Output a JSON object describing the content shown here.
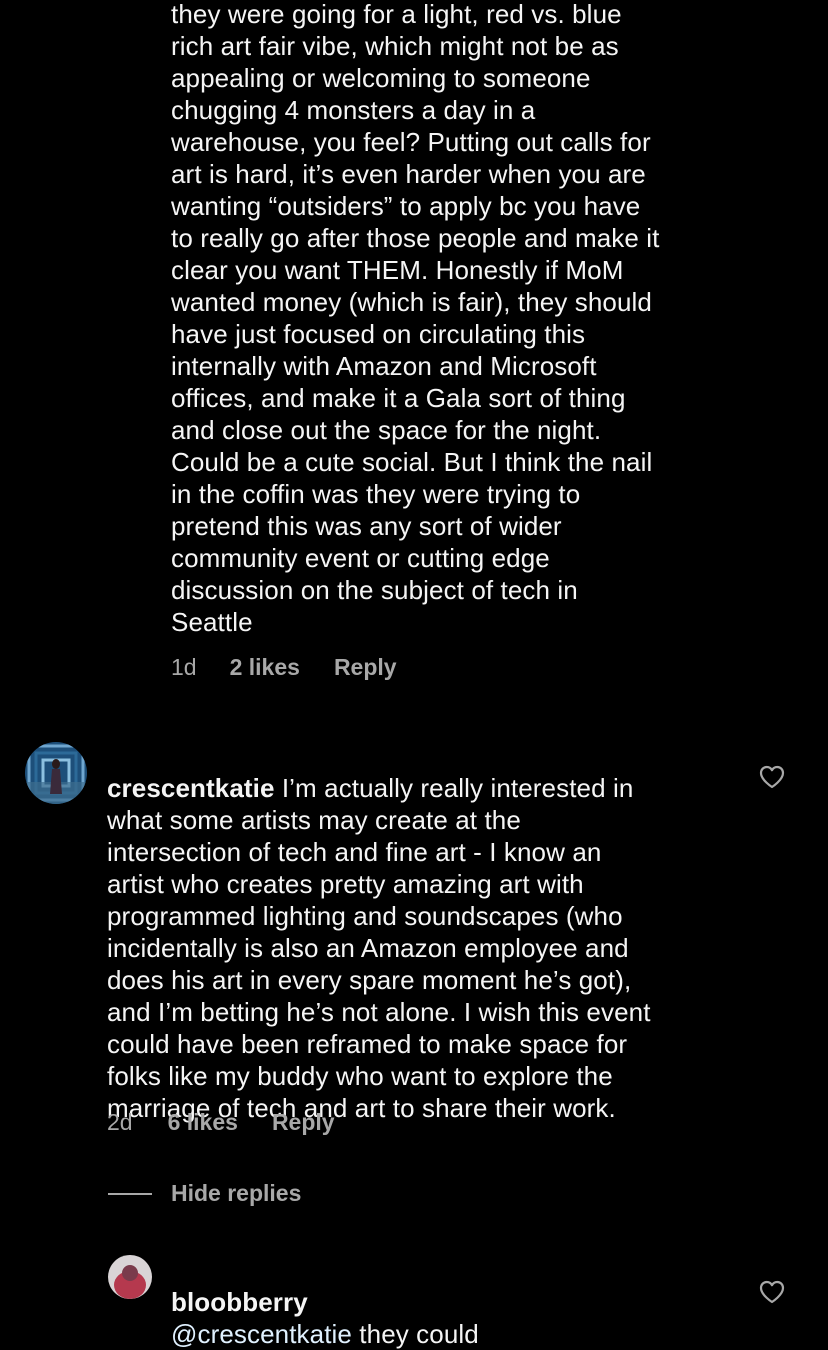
{
  "comments": [
    {
      "username": "",
      "text": "they were going for a light, red vs. blue\nrich art fair vibe, which might not be as\nappealing or welcoming to someone\nchugging 4 monsters a day in a\nwarehouse, you feel? Putting out calls for\nart is hard, it’s even harder when you are\nwanting “outsiders” to apply bc you have\nto really go after those people and make it\nclear you want THEM. Honestly if MoM\nwanted money (which is fair), they should\nhave just focused on circulating this\ninternally with Amazon and Microsoft\noffices, and make it a Gala sort of thing\nand close out the space for the night.\nCould be a cute social. But I think the nail\nin the coffin was they were trying to\npretend this was any sort of wider\ncommunity event or cutting edge\ndiscussion on the subject of tech in\nSeattle",
      "time": "1d",
      "likes": "2 likes",
      "reply": "Reply"
    },
    {
      "username": "crescentkatie",
      "text": " I’m actually really interested in\nwhat some artists may create at the\nintersection of tech and fine art - I know an\nartist who creates pretty amazing art with\nprogrammed lighting and soundscapes (who\nincidentally is also an Amazon employee and\ndoes his art in every spare moment he’s got),\nand I’m betting he’s not alone. I wish this event\ncould have been reframed to make space for\nfolks like my buddy who want to explore the\nmarriage of tech and art to share their work.",
      "time": "2d",
      "likes": "6 likes",
      "reply": "Reply"
    },
    {
      "username": "bloobberry",
      "mention": "@crescentkatie",
      "text": " they could"
    }
  ],
  "hide_replies": "Hide replies",
  "icons": {
    "like": "heart-outline-icon",
    "avatar_1": "avatar",
    "avatar_2": "avatar"
  },
  "colors": {
    "background": "#000000",
    "text": "#f5f5f5",
    "meta": "#a8a8a8"
  }
}
